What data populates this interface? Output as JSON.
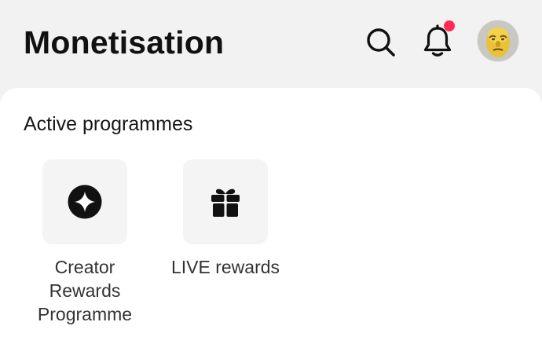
{
  "header": {
    "title": "Monetisation",
    "icons": {
      "search": "search-icon",
      "notifications": "bell-icon",
      "notification_dot_color": "#fe2c55",
      "avatar": "avatar-image"
    }
  },
  "active_programmes": {
    "heading": "Active programmes",
    "items": [
      {
        "label": "Creator Rewards Programme",
        "icon": "sparkle-icon"
      },
      {
        "label": "LIVE rewards",
        "icon": "gift-icon"
      }
    ]
  }
}
